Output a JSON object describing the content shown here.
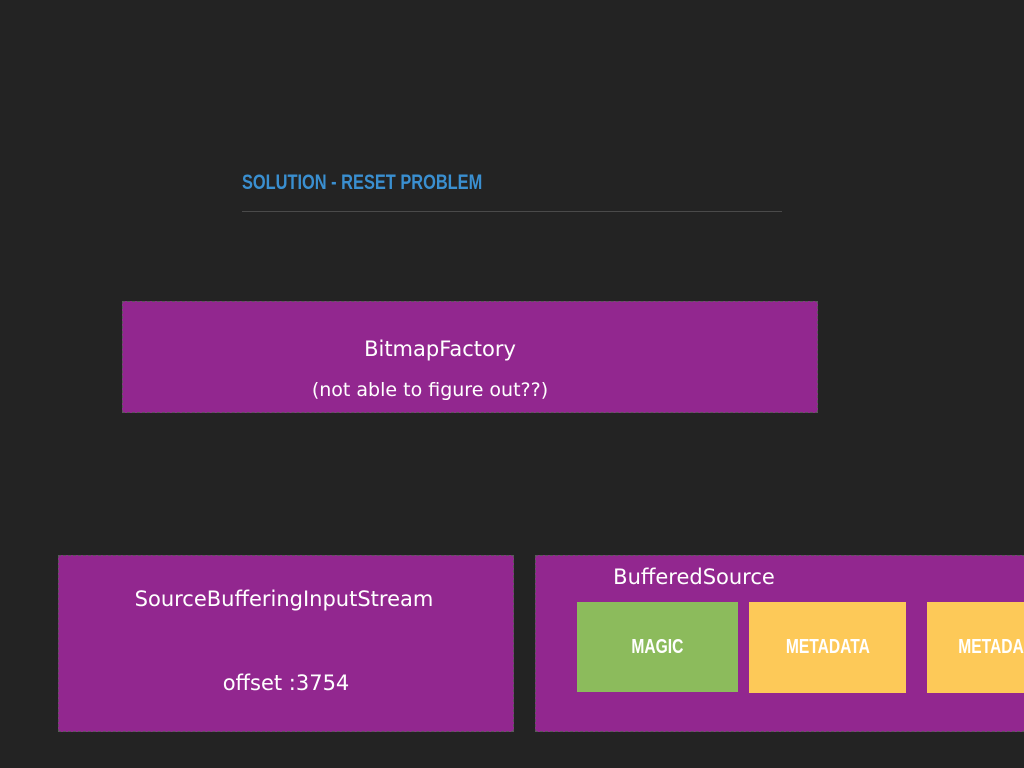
{
  "slide": {
    "title": "SOLUTION - RESET PROBLEM"
  },
  "bitmap_factory": {
    "name": "BitmapFactory",
    "note": "(not able to figure out??)"
  },
  "source_buffering_input_stream": {
    "name": "SourceBufferingInputStream",
    "offset": "offset :3754"
  },
  "buffered_source": {
    "name": "BufferedSource",
    "chunks": [
      {
        "label": "MAGIC",
        "color": "#8cbb5c"
      },
      {
        "label": "METADATA",
        "color": "#fdc958"
      },
      {
        "label": "METADA",
        "color": "#fdc958"
      }
    ]
  },
  "colors": {
    "background": "#232323",
    "box_fill": "#92278f",
    "title": "#3a8fd0",
    "magic": "#8cbb5c",
    "metadata": "#fdc958"
  }
}
